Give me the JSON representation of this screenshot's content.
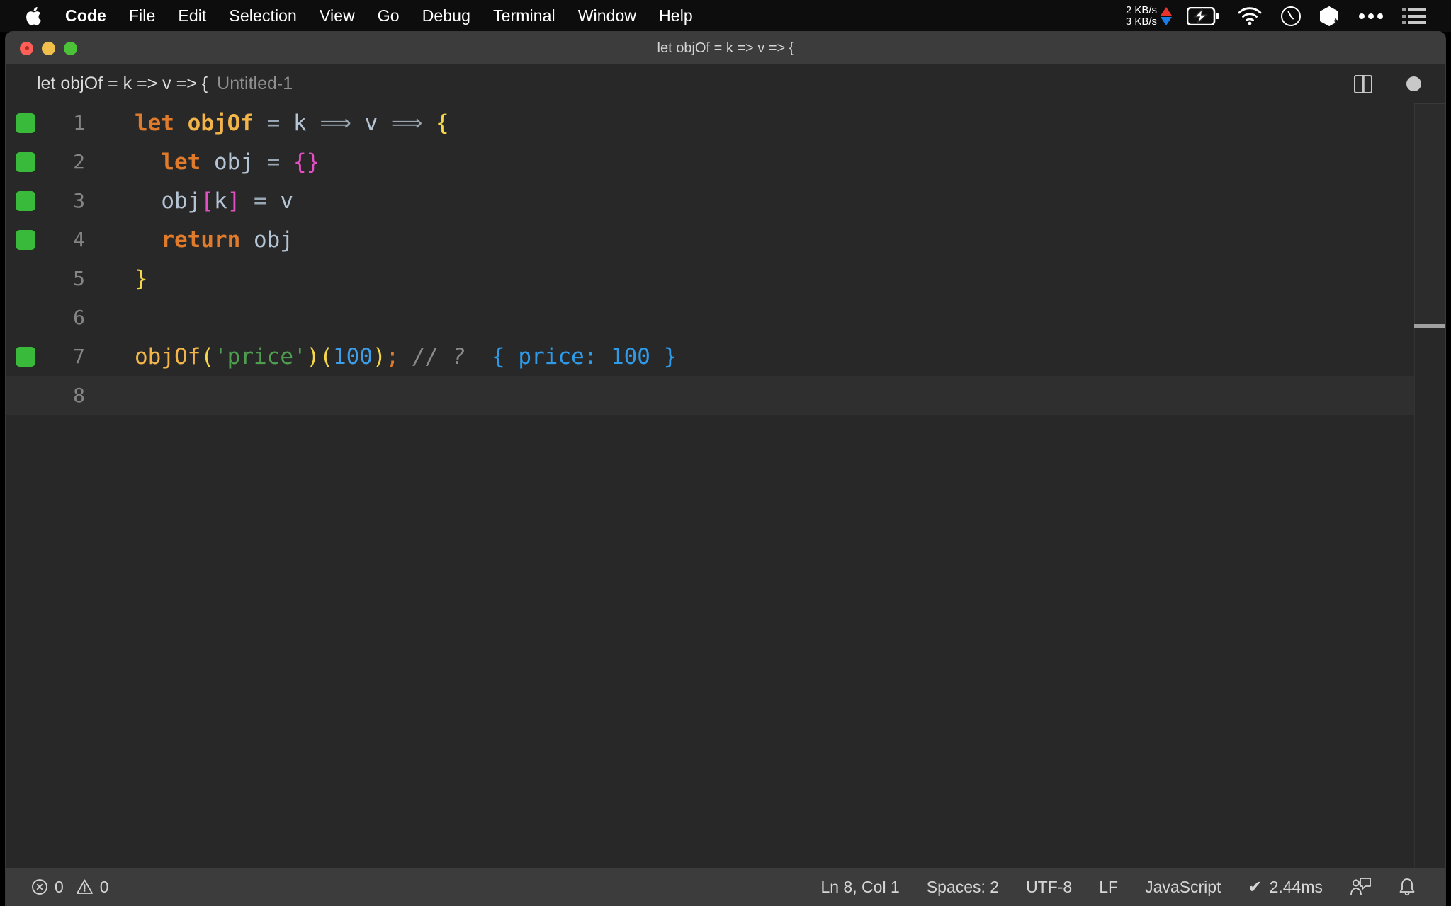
{
  "menubar": {
    "apple_icon": "apple-logo-icon",
    "items": [
      {
        "label": "Code",
        "bold": true
      },
      {
        "label": "File",
        "bold": false
      },
      {
        "label": "Edit",
        "bold": false
      },
      {
        "label": "Selection",
        "bold": false
      },
      {
        "label": "View",
        "bold": false
      },
      {
        "label": "Go",
        "bold": false
      },
      {
        "label": "Debug",
        "bold": false
      },
      {
        "label": "Terminal",
        "bold": false
      },
      {
        "label": "Window",
        "bold": false
      },
      {
        "label": "Help",
        "bold": false
      }
    ],
    "status": {
      "network_up": "2 KB/s",
      "network_down": "3 KB/s",
      "icons": [
        "battery-charging-icon",
        "wifi-icon",
        "clock-icon",
        "dropbox-icon",
        "ellipsis-icon",
        "control-center-list-icon"
      ]
    }
  },
  "window": {
    "title": "let objOf = k => v => {",
    "traffic_lights": [
      "close-button",
      "minimize-button",
      "maximize-button"
    ]
  },
  "breadcrumb": {
    "symbol": "let objOf = k => v => {",
    "file": "Untitled-1"
  },
  "editor_actions": {
    "split_icon": "split-editor-icon",
    "dirty_indicator": "unsaved-changes-dot"
  },
  "editor": {
    "language": "JavaScript",
    "lines": [
      {
        "number": "1",
        "live": true,
        "indent_guide": false,
        "tokens": [
          {
            "t": "let",
            "c": "tk-kw"
          },
          {
            "t": " ",
            "c": "tk-var"
          },
          {
            "t": "objOf",
            "c": "tk-fn"
          },
          {
            "t": " ",
            "c": "tk-var"
          },
          {
            "t": "=",
            "c": "tk-op"
          },
          {
            "t": " ",
            "c": "tk-var"
          },
          {
            "t": "k",
            "c": "tk-var"
          },
          {
            "t": " ",
            "c": "tk-var"
          },
          {
            "t": "⟹",
            "c": "tk-arrow"
          },
          {
            "t": " ",
            "c": "tk-var"
          },
          {
            "t": "v",
            "c": "tk-var"
          },
          {
            "t": " ",
            "c": "tk-var"
          },
          {
            "t": "⟹",
            "c": "tk-arrow"
          },
          {
            "t": " ",
            "c": "tk-var"
          },
          {
            "t": "{",
            "c": "tk-brace-y"
          }
        ]
      },
      {
        "number": "2",
        "live": true,
        "indent_guide": true,
        "tokens": [
          {
            "t": "  ",
            "c": "tk-var"
          },
          {
            "t": "let",
            "c": "tk-kw"
          },
          {
            "t": " ",
            "c": "tk-var"
          },
          {
            "t": "obj",
            "c": "tk-var"
          },
          {
            "t": " ",
            "c": "tk-var"
          },
          {
            "t": "=",
            "c": "tk-op"
          },
          {
            "t": " ",
            "c": "tk-var"
          },
          {
            "t": "{}",
            "c": "tk-brace-m"
          }
        ]
      },
      {
        "number": "3",
        "live": true,
        "indent_guide": true,
        "tokens": [
          {
            "t": "  ",
            "c": "tk-var"
          },
          {
            "t": "obj",
            "c": "tk-var"
          },
          {
            "t": "[",
            "c": "tk-brace-m"
          },
          {
            "t": "k",
            "c": "tk-var"
          },
          {
            "t": "]",
            "c": "tk-brace-m"
          },
          {
            "t": " ",
            "c": "tk-var"
          },
          {
            "t": "=",
            "c": "tk-op"
          },
          {
            "t": " ",
            "c": "tk-var"
          },
          {
            "t": "v",
            "c": "tk-var"
          }
        ]
      },
      {
        "number": "4",
        "live": true,
        "indent_guide": true,
        "tokens": [
          {
            "t": "  ",
            "c": "tk-var"
          },
          {
            "t": "return",
            "c": "tk-kw"
          },
          {
            "t": " ",
            "c": "tk-var"
          },
          {
            "t": "obj",
            "c": "tk-var"
          }
        ]
      },
      {
        "number": "5",
        "live": false,
        "indent_guide": false,
        "tokens": [
          {
            "t": "}",
            "c": "tk-brace-y"
          }
        ]
      },
      {
        "number": "6",
        "live": false,
        "indent_guide": false,
        "tokens": []
      },
      {
        "number": "7",
        "live": true,
        "indent_guide": false,
        "tokens": [
          {
            "t": "objOf",
            "c": "tk-fn-ln"
          },
          {
            "t": "(",
            "c": "tk-brace-y"
          },
          {
            "t": "'price'",
            "c": "tk-str"
          },
          {
            "t": ")",
            "c": "tk-brace-y"
          },
          {
            "t": "(",
            "c": "tk-brace-y"
          },
          {
            "t": "100",
            "c": "tk-num"
          },
          {
            "t": ")",
            "c": "tk-brace-y"
          },
          {
            "t": ";",
            "c": "tk-semi"
          },
          {
            "t": " ",
            "c": "tk-var"
          },
          {
            "t": "// ?",
            "c": "tk-comment"
          },
          {
            "t": "  ",
            "c": "tk-var"
          },
          {
            "t": "{ price: 100 }",
            "c": "tk-result"
          }
        ]
      },
      {
        "number": "8",
        "live": false,
        "indent_guide": false,
        "current": true,
        "tokens": []
      }
    ]
  },
  "statusbar": {
    "errors_icon": "error-circle-icon",
    "errors": "0",
    "warnings_icon": "warning-triangle-icon",
    "warnings": "0",
    "cursor_position": "Ln 8, Col 1",
    "indentation": "Spaces: 2",
    "encoding": "UTF-8",
    "eol": "LF",
    "language_mode": "JavaScript",
    "run_status_check": "✔",
    "run_status_time": "2.44ms",
    "feedback_icon": "tweet-feedback-icon",
    "notifications_icon": "bell-icon"
  }
}
